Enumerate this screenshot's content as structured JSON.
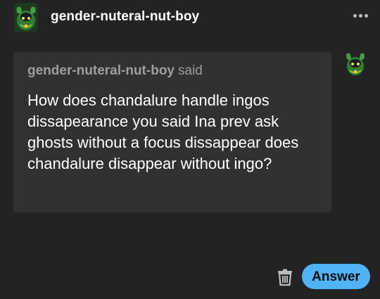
{
  "post": {
    "header": {
      "username": "gender-nuteral-nut-boy",
      "avatar_icon": "green-ghost-pokemon-avatar",
      "more_icon": "more-horizontal-icon"
    },
    "ask": {
      "asker": "gender-nuteral-nut-boy",
      "said_label": "said",
      "question": "How does chandalure handle ingos dissapearance you said Ina prev ask ghosts without a focus dissappear does chandalure disappear without ingo?",
      "asker_avatar_icon": "green-ghost-pokemon-avatar"
    },
    "actions": {
      "delete_icon": "trash-icon",
      "answer_label": "Answer"
    }
  },
  "colors": {
    "background": "#232323",
    "bubble": "#313131",
    "accent": "#4fb3f6",
    "muted_text": "#9e9e9e"
  }
}
